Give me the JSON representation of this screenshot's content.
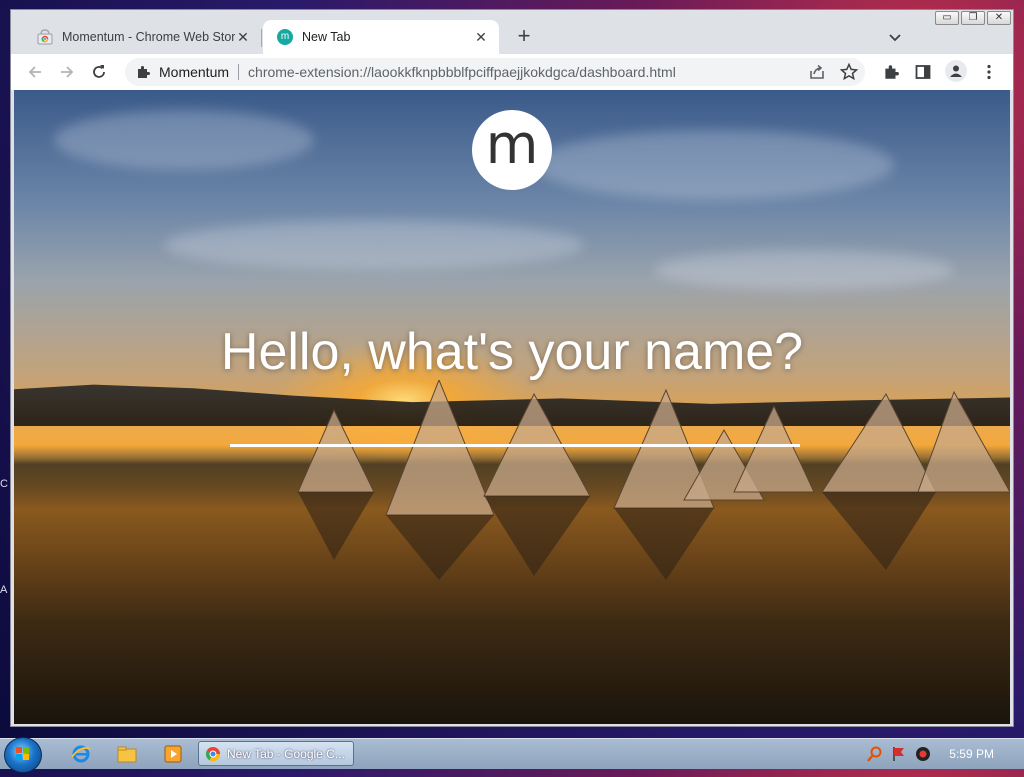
{
  "browser": {
    "tabs": [
      {
        "label": "Momentum - Chrome Web Store",
        "active": false,
        "favicon": "chrome-web-store-icon"
      },
      {
        "label": "New Tab",
        "active": true,
        "favicon": "momentum-m-icon",
        "favicon_letter": "m"
      }
    ],
    "new_tab_symbol": "+",
    "window_controls": {
      "minimize": "▭",
      "restore": "❐",
      "close": "✕"
    },
    "omnibox": {
      "chip": "Momentum",
      "url": "chrome-extension://laookkfknpbbblfpciffpaejjkokdgca/dashboard.html"
    },
    "icons": [
      "back-icon",
      "forward-icon",
      "reload-icon",
      "extension-icon",
      "share-icon",
      "star-icon",
      "extensions-puzzle-icon",
      "side-panel-icon",
      "profile-icon",
      "menu-dots-icon",
      "tab-search-icon"
    ]
  },
  "page": {
    "logo_letter": "m",
    "greeting": "Hello, what's your name?",
    "name_value": ""
  },
  "taskbar": {
    "task_label": "New Tab - Google C...",
    "clock": "5:59 PM"
  },
  "desktop": {
    "left_glyphs": [
      "C",
      "A"
    ]
  },
  "colors": {
    "tab_strip": "#dee1e6",
    "toolbar": "#ffffff",
    "omnibox": "#f1f3f4",
    "momentum_teal": "#15a9a1",
    "taskbar": "#9fb3cb"
  }
}
